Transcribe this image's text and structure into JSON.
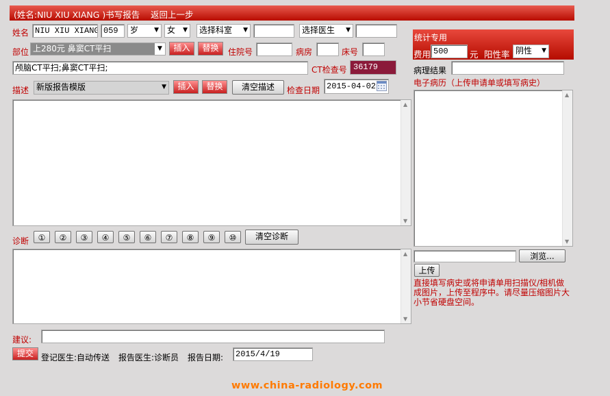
{
  "header": {
    "title": "(姓名:NIU XIU XIANG )书写报告",
    "back_link": "返回上一步"
  },
  "patient": {
    "name_label": "姓名",
    "name_value": "NIU XIU XIANG",
    "age_value": "059",
    "age_unit": "岁",
    "gender": "女",
    "department_select": "选择科室",
    "doctor_select": "选择医生"
  },
  "site": {
    "label": "部位",
    "selected": "上280元 鼻窦CT平扫",
    "insert_label": "插入",
    "replace_label": "替换",
    "inpatient_no_label": "住院号",
    "ward_label": "病房",
    "bed_label": "床号",
    "site_text": "颅脑CT平扫;鼻窦CT平扫;",
    "ct_no_label": "CT检查号",
    "ct_no_value": "36179"
  },
  "description": {
    "label": "描述",
    "template_selected": "新版报告模版",
    "insert_label": "插入",
    "replace_label": "替换",
    "clear_label": "清空描述",
    "exam_date_label": "检查日期",
    "exam_date_value": "2015-04-02"
  },
  "diagnosis": {
    "label": "诊断",
    "quick_buttons": [
      "①",
      "②",
      "③",
      "④",
      "⑤",
      "⑥",
      "⑦",
      "⑧",
      "⑨",
      "⑩"
    ],
    "clear_label": "清空诊断"
  },
  "advice": {
    "label": "建议:"
  },
  "footer": {
    "submit_label": "提交",
    "reg_doctor": "登记医生:自动传送",
    "report_doctor": "报告医生:诊断员",
    "report_date_label": "报告日期:",
    "report_date_value": "2015/4/19",
    "watermark": "www.china-radiology.com"
  },
  "stats": {
    "title": "统计专用",
    "fee_label": "费用",
    "fee_value": "500",
    "fee_unit": "元",
    "positive_label": "阳性率",
    "positive_value": "阴性",
    "pathology_label": "病理结果",
    "emr_label": "电子病历（上传申请单或填写病史）",
    "browse_label": "浏览...",
    "upload_label": "上传",
    "upload_hint": "直接填写病史或将申请单用扫描仪/相机做成图片，上传至程序中。请尽量压缩图片大小节省硬盘空间。"
  },
  "colors": {
    "accent_red": "#c00000",
    "ct_no_bg": "#8b1a3a",
    "page_bg": "#dcdada"
  }
}
